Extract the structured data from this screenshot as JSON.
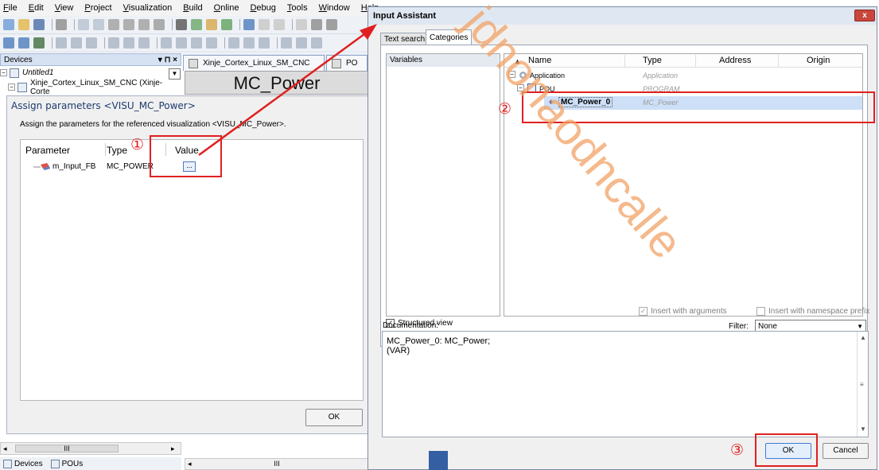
{
  "ide": {
    "menu": [
      "File",
      "Edit",
      "View",
      "Project",
      "Visualization",
      "Build",
      "Online",
      "Debug",
      "Tools",
      "Window",
      "Help"
    ],
    "devices_panel": {
      "title": "Devices",
      "pin": "▾ ⊓ ×"
    },
    "tree": [
      {
        "label": "Untitled1"
      },
      {
        "label": "Xinje_Cortex_Linux_SM_CNC (Xinje-Corte"
      }
    ],
    "editor_tabs": [
      {
        "label": "Xinje_Cortex_Linux_SM_CNC"
      },
      {
        "label": "PO"
      }
    ],
    "visu_caption": "MC_Power",
    "bottom_tabs": [
      "Devices",
      "POUs"
    ],
    "scroll_mark": "III"
  },
  "assign_dialog": {
    "title": "Assign parameters <VISU_MC_Power>",
    "description": "Assign the parameters for the referenced visualization <VISU_MC_Power>.",
    "columns": {
      "parameter": "Parameter",
      "type": "Type",
      "value": "Value"
    },
    "row": {
      "parameter": "m_Input_FB",
      "type": "MC_POWER",
      "value_button": "..."
    },
    "ok": "OK"
  },
  "input_assistant": {
    "title": "Input Assistant",
    "close": "x",
    "tabs": {
      "text_search": "Text search",
      "categories": "Categories"
    },
    "category": "Variables",
    "columns": {
      "name": "Name",
      "type": "Type",
      "address": "Address",
      "origin": "Origin",
      "sort_icon": "▲"
    },
    "rows": [
      {
        "name": "Application",
        "type": "Application"
      },
      {
        "name": "POU",
        "type": "PROGRAM"
      },
      {
        "name": "MC_Power_0",
        "type": "MC_Power"
      }
    ],
    "structured_view": "Structured view",
    "filter_label": "Filter:",
    "filter_value": "None",
    "insert_with_arguments": "Insert with arguments",
    "insert_with_namespace": "Insert with namespace prefix",
    "documentation_label": "Documentation:",
    "documentation_line1": "MC_Power_0: MC_Power;",
    "documentation_line2": "(VAR)",
    "ok": "OK",
    "cancel": "Cancel"
  },
  "annotations": {
    "step1": "①",
    "step2": "②",
    "step3": "③",
    "color": "#e02020"
  },
  "watermark": {
    "text": "jdnonaodncalle",
    "color": "#f1a266"
  }
}
